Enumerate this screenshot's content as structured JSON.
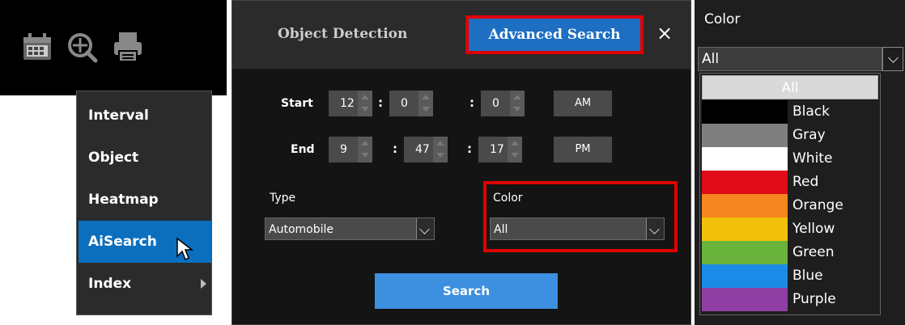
{
  "toolbar": {
    "icons": [
      "calendar-icon",
      "zoom-icon",
      "print-icon"
    ]
  },
  "menu": {
    "items": [
      {
        "label": "Interval"
      },
      {
        "label": "Object"
      },
      {
        "label": "Heatmap"
      },
      {
        "label": "AiSearch",
        "active": true
      },
      {
        "label": "Index",
        "has_submenu": true
      }
    ]
  },
  "dialog": {
    "tabs": [
      {
        "label": "Object Detection"
      },
      {
        "label": "Advanced Search",
        "active": true
      }
    ],
    "close_label": "×",
    "start": {
      "label": "Start",
      "hour": "12",
      "minute": "0",
      "second": "0",
      "ampm": "AM"
    },
    "end": {
      "label": "End",
      "hour": "9",
      "minute": "47",
      "second": "17",
      "ampm": "PM"
    },
    "time_separator": ":",
    "type": {
      "label": "Type",
      "value": "Automobile"
    },
    "color": {
      "label": "Color",
      "value": "All"
    },
    "search_label": "Search"
  },
  "color_panel": {
    "title": "Color",
    "selected": "All",
    "options": [
      {
        "label": "All",
        "swatch": "#d9d9d9"
      },
      {
        "label": "Black",
        "swatch": "#000000"
      },
      {
        "label": "Gray",
        "swatch": "#7f7f7f"
      },
      {
        "label": "White",
        "swatch": "#ffffff"
      },
      {
        "label": "Red",
        "swatch": "#e00c17"
      },
      {
        "label": "Orange",
        "swatch": "#f68620"
      },
      {
        "label": "Yellow",
        "swatch": "#f2c10c"
      },
      {
        "label": "Green",
        "swatch": "#69b33c"
      },
      {
        "label": "Blue",
        "swatch": "#1a8ce8"
      },
      {
        "label": "Purple",
        "swatch": "#8f3fa4"
      }
    ]
  },
  "colors": {
    "accent": "#1e6fc2",
    "highlight": "#e00000",
    "menu_active": "#0b6fbe",
    "button": "#3d8fe0"
  }
}
